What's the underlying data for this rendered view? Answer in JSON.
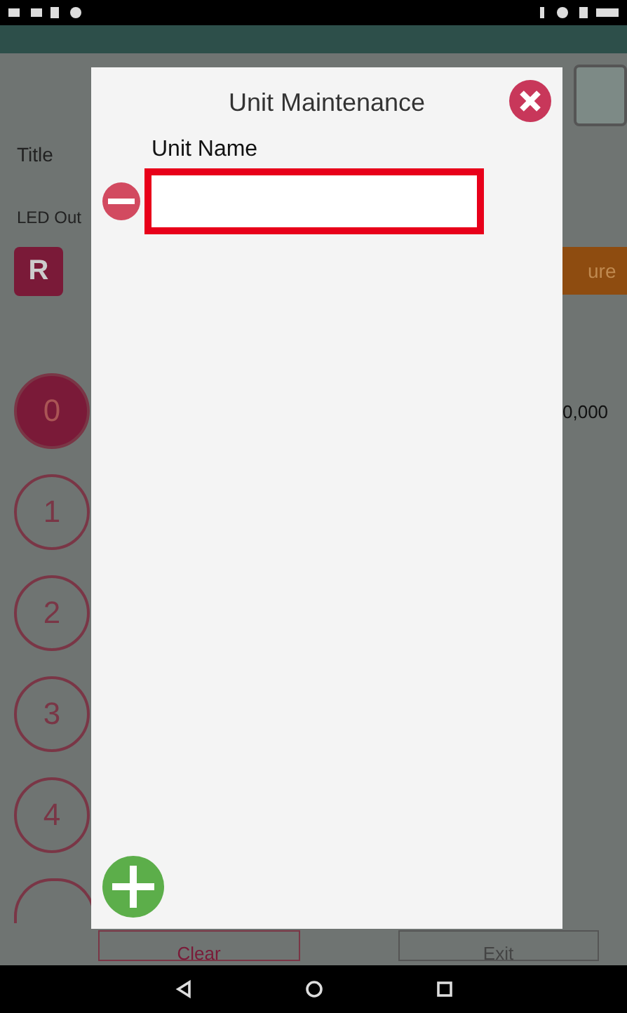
{
  "background": {
    "title_label": "Title",
    "led_label": "LED Out",
    "r_button": "R",
    "action_button": "ure",
    "value": "0,000",
    "channels": [
      {
        "label": "0",
        "selected": true
      },
      {
        "label": "1",
        "selected": false
      },
      {
        "label": "2",
        "selected": false
      },
      {
        "label": "3",
        "selected": false
      },
      {
        "label": "4",
        "selected": false
      }
    ],
    "footer_buttons": [
      "Clear",
      "Exit"
    ]
  },
  "dialog": {
    "title": "Unit Maintenance",
    "field_label": "Unit Name",
    "unit_rows": [
      {
        "highlighted": true
      }
    ]
  }
}
